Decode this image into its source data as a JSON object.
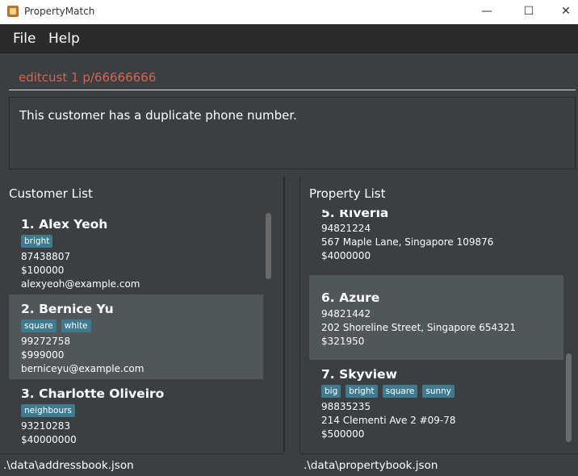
{
  "window": {
    "title": "PropertyMatch",
    "minimize_glyph": "—",
    "maximize_glyph": "☐",
    "close_glyph": "✕"
  },
  "menu": {
    "file_label": "File",
    "help_label": "Help"
  },
  "command": {
    "value": "editcust 1 p/66666666"
  },
  "result": {
    "message": "This customer has a duplicate phone number."
  },
  "customer_panel": {
    "title": "Customer List",
    "items": [
      {
        "name": "1.  Alex Yeoh",
        "tags": [
          "bright"
        ],
        "phone": "87438807",
        "budget": "$100000",
        "email": "alexyeoh@example.com"
      },
      {
        "name": "2.  Bernice Yu",
        "tags": [
          "square",
          "white"
        ],
        "phone": "99272758",
        "budget": "$999000",
        "email": "berniceyu@example.com"
      },
      {
        "name": "3.  Charlotte Oliveiro",
        "tags": [
          "neighbours"
        ],
        "phone": "93210283",
        "budget": "$40000000"
      }
    ],
    "footer": ".\\data\\addressbook.json"
  },
  "property_panel": {
    "title": "Property List",
    "items": [
      {
        "name": "5.  Riveria",
        "tags": [],
        "phone": "94821224",
        "address": "567 Maple Lane, Singapore 109876",
        "price": "$4000000"
      },
      {
        "name": "6.  Azure",
        "tags": [],
        "phone": "94821442",
        "address": "202 Shoreline Street, Singapore 654321",
        "price": "$321950"
      },
      {
        "name": "7.  Skyview",
        "tags": [
          "big",
          "bright",
          "square",
          "sunny"
        ],
        "phone": "98835235",
        "address": "214 Clementi Ave 2 #09-78",
        "price": "$500000"
      }
    ],
    "footer": ".\\data\\propertybook.json"
  },
  "colors": {
    "background": "#3c3f41",
    "menubar": "#2b2b2b",
    "selected_card": "#515658",
    "tag": "#3e7b91",
    "command_text": "#d06651"
  }
}
